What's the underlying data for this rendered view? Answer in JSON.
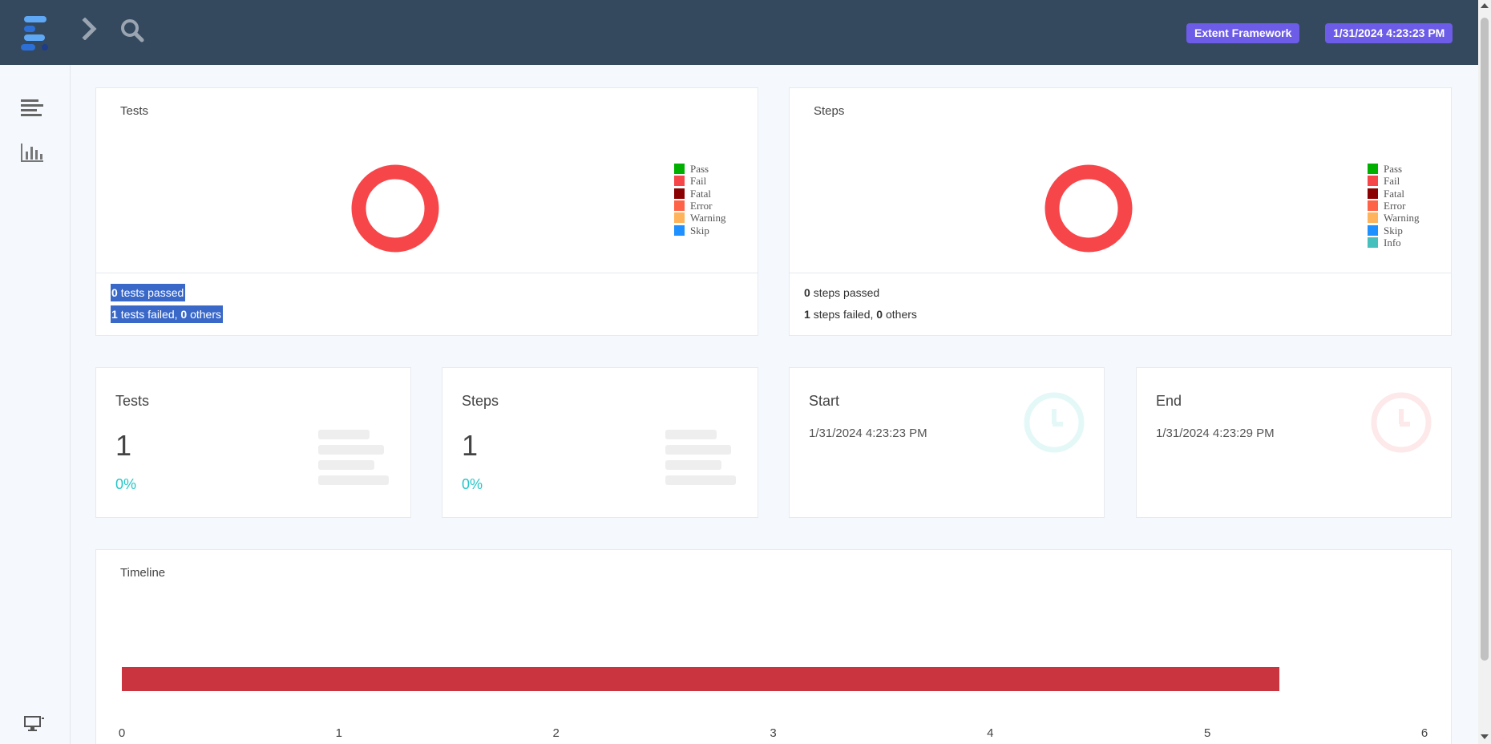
{
  "header": {
    "framework_badge": "Extent Framework",
    "datetime_badge": "1/31/2024 4:23:23 PM"
  },
  "colors": {
    "topbar": "#34495e",
    "badge": "#6c5ce7",
    "fail": "#f7464a",
    "timeline_bar": "#c9343f",
    "teal": "#23c6c8"
  },
  "icons": {
    "logo": "extent-logo-icon",
    "nav_toggle": "chevron-right-icon",
    "search": "search-icon",
    "dashboard": "align-left-icon",
    "analytics": "bar-chart-icon",
    "environment": "desktop-icon",
    "start_clock": "clock-icon",
    "end_clock": "clock-icon"
  },
  "tests_chart": {
    "title": "Tests",
    "legend": [
      {
        "label": "Pass",
        "color": "#00af00"
      },
      {
        "label": "Fail",
        "color": "#f7464a"
      },
      {
        "label": "Fatal",
        "color": "#8b0000"
      },
      {
        "label": "Error",
        "color": "#ff6347"
      },
      {
        "label": "Warning",
        "color": "#ffb45b"
      },
      {
        "label": "Skip",
        "color": "#1e90ff"
      }
    ],
    "passed_count": "0",
    "passed_text": "tests passed",
    "failed_count": "1",
    "failed_text": "tests failed,",
    "others_count": "0",
    "others_text": "others"
  },
  "steps_chart": {
    "title": "Steps",
    "legend": [
      {
        "label": "Pass",
        "color": "#00af00"
      },
      {
        "label": "Fail",
        "color": "#f7464a"
      },
      {
        "label": "Fatal",
        "color": "#8b0000"
      },
      {
        "label": "Error",
        "color": "#ff6347"
      },
      {
        "label": "Warning",
        "color": "#ffb45b"
      },
      {
        "label": "Skip",
        "color": "#1e90ff"
      },
      {
        "label": "Info",
        "color": "#46bfbd"
      }
    ],
    "passed_count": "0",
    "passed_text": "steps passed",
    "failed_count": "1",
    "failed_text": "steps failed,",
    "others_count": "0",
    "others_text": "others"
  },
  "stats": {
    "tests": {
      "title": "Tests",
      "count": "1",
      "percent": "0%"
    },
    "steps": {
      "title": "Steps",
      "count": "1",
      "percent": "0%"
    },
    "start": {
      "title": "Start",
      "time": "1/31/2024 4:23:23 PM"
    },
    "end": {
      "title": "End",
      "time": "1/31/2024 4:23:29 PM"
    }
  },
  "timeline": {
    "title": "Timeline"
  },
  "chart_data": [
    {
      "type": "pie",
      "title": "Tests",
      "labels": [
        "Pass",
        "Fail",
        "Fatal",
        "Error",
        "Warning",
        "Skip"
      ],
      "values": [
        0,
        1,
        0,
        0,
        0,
        0
      ],
      "legend": "right"
    },
    {
      "type": "pie",
      "title": "Steps",
      "labels": [
        "Pass",
        "Fail",
        "Fatal",
        "Error",
        "Warning",
        "Skip",
        "Info"
      ],
      "values": [
        0,
        1,
        0,
        0,
        0,
        0,
        0
      ],
      "legend": "right"
    },
    {
      "type": "bar",
      "title": "Timeline",
      "orientation": "horizontal",
      "values": [
        5.33
      ],
      "xlim": [
        0,
        6
      ],
      "xticks": [
        "0",
        "1",
        "2",
        "3",
        "4",
        "5",
        "6"
      ],
      "grid": false
    }
  ]
}
